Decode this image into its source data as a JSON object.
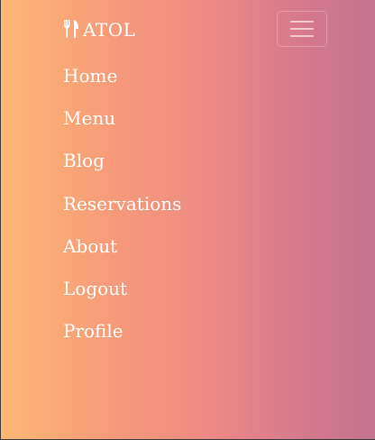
{
  "navbar": {
    "brand_icon": "fork-knife-icon",
    "brand_name": "ATOL",
    "toggler_icon": "hamburger-menu-icon",
    "text_color": "#ffffff",
    "gradient": [
      "#fdb872",
      "#f79a7a",
      "#ee8a84",
      "#d67a8c",
      "#c5738f"
    ]
  },
  "menu": {
    "items": [
      {
        "label": "Home"
      },
      {
        "label": "Menu"
      },
      {
        "label": "Blog"
      },
      {
        "label": "Reservations"
      },
      {
        "label": "About"
      },
      {
        "label": "Logout"
      },
      {
        "label": "Profile"
      }
    ]
  }
}
